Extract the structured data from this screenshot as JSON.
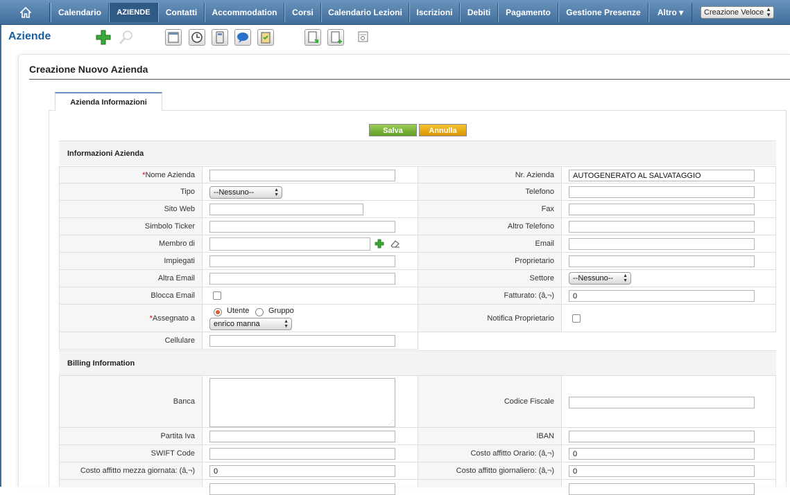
{
  "nav": {
    "home_icon": "home-icon",
    "items": [
      {
        "label": "Calendario",
        "active": false
      },
      {
        "label": "AZIENDE",
        "active": true
      },
      {
        "label": "Contatti",
        "active": false
      },
      {
        "label": "Accommodation",
        "active": false
      },
      {
        "label": "Corsi",
        "active": false
      },
      {
        "label": "Calendario Lezioni",
        "active": false
      },
      {
        "label": "Iscrizioni",
        "active": false
      },
      {
        "label": "Debiti",
        "active": false
      },
      {
        "label": "Pagamento",
        "active": false
      },
      {
        "label": "Gestione Presenze",
        "active": false
      },
      {
        "label": "Altro ▾",
        "active": false
      }
    ],
    "quick_create": "Creazione Veloce"
  },
  "module": {
    "title": "Aziende"
  },
  "toolbar": {
    "icons": [
      "add-icon",
      "search-icon",
      "calendar-icon",
      "clock-icon",
      "calculator-icon",
      "chat-icon",
      "clipboard-icon",
      "import-icon",
      "export-icon",
      "find-duplicates-icon"
    ]
  },
  "form": {
    "heading": "Creazione Nuovo Azienda",
    "tab": "Azienda Informazioni",
    "save_label": "Salva",
    "cancel_label": "Annulla",
    "section1": {
      "title": "Informazioni Azienda",
      "nome_azienda": {
        "label": "Nome Azienda",
        "required_mark": "*",
        "value": ""
      },
      "nr_azienda": {
        "label": "Nr. Azienda",
        "value": "AUTOGENERATO AL SALVATAGGIO"
      },
      "tipo": {
        "label": "Tipo",
        "value": "--Nessuno--"
      },
      "telefono": {
        "label": "Telefono",
        "value": ""
      },
      "sito_web": {
        "label": "Sito Web",
        "value": ""
      },
      "fax": {
        "label": "Fax",
        "value": ""
      },
      "simbolo_ticker": {
        "label": "Simbolo Ticker",
        "value": ""
      },
      "altro_telefono": {
        "label": "Altro Telefono",
        "value": ""
      },
      "membro_di": {
        "label": "Membro di",
        "value": ""
      },
      "email": {
        "label": "Email",
        "value": ""
      },
      "impiegati": {
        "label": "Impiegati",
        "value": ""
      },
      "proprietario": {
        "label": "Proprietario",
        "value": ""
      },
      "altra_email": {
        "label": "Altra Email",
        "value": ""
      },
      "settore": {
        "label": "Settore",
        "value": "--Nessuno--"
      },
      "blocca_email": {
        "label": "Blocca Email",
        "checked": false
      },
      "fatturato": {
        "label": "Fatturato: (â‚¬)",
        "value": "0"
      },
      "assegnato_a": {
        "label": "Assegnato a",
        "required_mark": "*",
        "option_user": "Utente",
        "option_group": "Gruppo",
        "selected": "Utente",
        "user_value": "enrico manna"
      },
      "notifica_proprietario": {
        "label": "Notifica Proprietario",
        "checked": false
      },
      "cellulare": {
        "label": "Cellulare",
        "value": ""
      }
    },
    "section2": {
      "title": "Billing Information",
      "banca": {
        "label": "Banca",
        "value": ""
      },
      "codice_fiscale": {
        "label": "Codice Fiscale",
        "value": ""
      },
      "partita_iva": {
        "label": "Partita Iva",
        "value": ""
      },
      "iban": {
        "label": "IBAN",
        "value": ""
      },
      "swift": {
        "label": "SWIFT Code",
        "value": ""
      },
      "costo_orario": {
        "label": "Costo affitto Orario: (â‚¬)",
        "value": "0"
      },
      "costo_mezza": {
        "label": "Costo affitto mezza giornata: (â‚¬)",
        "value": "0"
      },
      "costo_giornaliero": {
        "label": "Costo affitto giornaliero: (â‚¬)",
        "value": "0"
      }
    }
  }
}
